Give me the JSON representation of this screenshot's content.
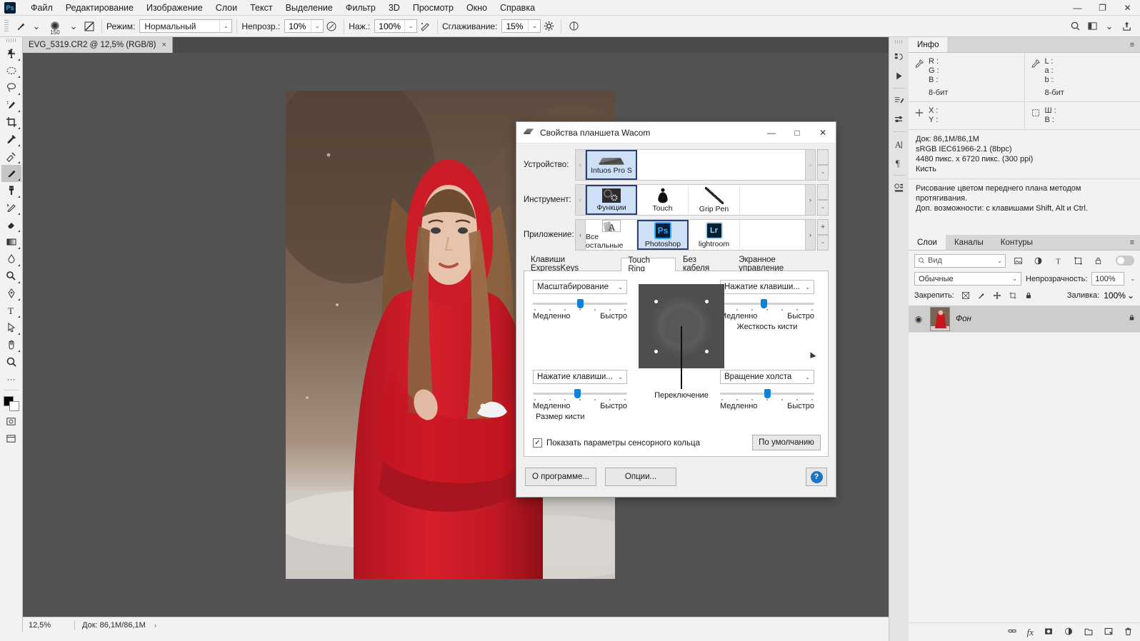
{
  "app": {
    "logo_text": "Ps",
    "menu": [
      "Файл",
      "Редактирование",
      "Изображение",
      "Слои",
      "Текст",
      "Выделение",
      "Фильтр",
      "3D",
      "Просмотр",
      "Окно",
      "Справка"
    ],
    "window_controls": {
      "minimize": "—",
      "maximize": "❐",
      "close": "✕"
    }
  },
  "options_bar": {
    "brush_size": "150",
    "mode_label": "Режим:",
    "mode_value": "Нормальный",
    "opacity_label": "Непрозр.:",
    "opacity_value": "10%",
    "pressure_label": "Наж.:",
    "pressure_value": "100%",
    "smoothing_label": "Сглаживание:",
    "smoothing_value": "15%",
    "icons": [
      "brush-tool-icon",
      "brush-preset-picker-icon",
      "brush-panel-icon",
      "airbrush-icon",
      "pressure-opacity-icon",
      "pressure-size-icon",
      "smoothing-options-gear-icon",
      "symmetry-icon"
    ],
    "right_icons": [
      "search-icon",
      "workspace-switcher-icon",
      "chevron-down-icon",
      "share-icon"
    ]
  },
  "document_tab": {
    "title": "EVG_5319.CR2 @ 12,5% (RGB/8)",
    "close": "×"
  },
  "toolbar": {
    "tools": [
      {
        "name": "move-tool",
        "glyph": "move"
      },
      {
        "name": "elliptical-marquee-tool",
        "glyph": "ellipse"
      },
      {
        "name": "lasso-tool",
        "glyph": "lasso"
      },
      {
        "name": "quick-selection-tool",
        "glyph": "quickselect"
      },
      {
        "name": "crop-tool",
        "glyph": "crop"
      },
      {
        "name": "eyedropper-tool",
        "glyph": "eyedropper"
      },
      {
        "name": "spot-healing-brush-tool",
        "glyph": "healing"
      },
      {
        "name": "brush-tool",
        "glyph": "brush",
        "active": true
      },
      {
        "name": "clone-stamp-tool",
        "glyph": "stamp"
      },
      {
        "name": "history-brush-tool",
        "glyph": "historybrush"
      },
      {
        "name": "eraser-tool",
        "glyph": "eraser"
      },
      {
        "name": "gradient-tool",
        "glyph": "gradient"
      },
      {
        "name": "blur-tool",
        "glyph": "blur"
      },
      {
        "name": "dodge-tool",
        "glyph": "dodge"
      },
      {
        "name": "pen-tool",
        "glyph": "pen"
      },
      {
        "name": "type-tool",
        "glyph": "type"
      },
      {
        "name": "path-selection-tool",
        "glyph": "pathselect"
      },
      {
        "name": "rectangle-tool",
        "glyph": "rect"
      },
      {
        "name": "hand-tool",
        "glyph": "hand"
      },
      {
        "name": "zoom-tool",
        "glyph": "zoom"
      }
    ],
    "more_tools": "···",
    "foreground_color": "#000000",
    "background_color": "#ffffff",
    "extra": [
      "quick-mask-icon",
      "screen-mode-icon"
    ]
  },
  "status_bar": {
    "zoom": "12,5%",
    "doc": "Док: 86,1M/86,1M",
    "arrow": "›"
  },
  "dock_rail": {
    "icons": [
      "history-icon",
      "play-icon",
      "actions-icon",
      "adjustments-icon",
      "character-icon",
      "paragraph-icon",
      "libraries-icon"
    ]
  },
  "info_panel": {
    "tab": "Инфо",
    "menu_icon": "panel-menu-icon",
    "left_readout": {
      "icon": "eyedropper-icon",
      "rows": [
        "R :",
        "G :",
        "B :"
      ],
      "bits": "8-бит"
    },
    "right_readout": {
      "icon": "eyedropper-icon",
      "rows": [
        "L :",
        "a :",
        "b :"
      ],
      "bits": "8-бит"
    },
    "coords": {
      "icon": "crosshair-icon",
      "rows": [
        "X :",
        "Y :"
      ]
    },
    "dimensions": {
      "icon": "selection-size-icon",
      "rows": [
        "Ш :",
        "В :"
      ]
    },
    "doc_lines": [
      "Док: 86,1M/86,1M",
      "sRGB IEC61966-2.1 (8bpc)",
      "4480 пикс. x 6720 пикс. (300 ppi)",
      "Кисть"
    ],
    "hint_lines": [
      "Рисование цветом переднего плана методом протягивания.",
      "Доп. возможности: с клавишами Shift, Alt и Ctrl."
    ]
  },
  "layers_panel": {
    "tabs": [
      "Слои",
      "Каналы",
      "Контуры"
    ],
    "active_tab": "Слои",
    "menu_icon": "panel-menu-icon",
    "filter_placeholder": "Вид",
    "filter_icons": [
      "filter-pixel-icon",
      "filter-adjustment-icon",
      "filter-type-icon",
      "filter-shape-icon",
      "filter-smart-icon"
    ],
    "blend_mode": "Обычные",
    "opacity_label": "Непрозрачность:",
    "opacity_value": "100%",
    "lock_label": "Закрепить:",
    "lock_icons": [
      "lock-transparent-icon",
      "lock-image-icon",
      "lock-position-icon",
      "lock-artboard-icon",
      "lock-all-icon"
    ],
    "fill_label": "Заливка:",
    "fill_value": "100%",
    "rows": [
      {
        "name": "Фон",
        "visible": true,
        "locked": true,
        "eye": "◉",
        "lock": "🔒"
      }
    ],
    "bottom_icons": [
      "link-layers-icon",
      "layer-style-fx-icon",
      "add-mask-icon",
      "adjustment-layer-icon",
      "new-group-icon",
      "new-layer-icon",
      "delete-layer-icon"
    ],
    "fx_label": "fx"
  },
  "wacom_dialog": {
    "title": "Свойства планшета Wacom",
    "title_icon": "tablet-icon",
    "window_controls": {
      "minimize": "—",
      "maximize": "□",
      "close": "✕"
    },
    "rows": [
      {
        "label": "Устройство:",
        "prev": "‹",
        "next": "›",
        "items": [
          {
            "label": "Intuos Pro S",
            "icon": "tablet-icon",
            "selected": true
          }
        ]
      },
      {
        "label": "Инструмент:",
        "prev": "‹",
        "next": "›",
        "items": [
          {
            "label": "Функции",
            "icon": "functions-icon",
            "selected": true
          },
          {
            "label": "Touch",
            "icon": "touch-icon",
            "selected": false
          },
          {
            "label": "Grip Pen",
            "icon": "pen-icon",
            "selected": false
          }
        ]
      },
      {
        "label": "Приложение:",
        "prev": "‹",
        "next": "›",
        "items": [
          {
            "label": "Все остальные",
            "icon": "all-other-apps-icon",
            "selected": false
          },
          {
            "label": "Photoshop",
            "icon": "photoshop-icon",
            "selected": true
          },
          {
            "label": "lightroom",
            "icon": "lightroom-icon",
            "selected": false
          }
        ],
        "add": "+",
        "remove": "-"
      }
    ],
    "tabs": [
      "Клавиши ExpressKeys",
      "Touch Ring",
      "Без кабеля",
      "Экранное управление"
    ],
    "active_tab": "Touch Ring",
    "controls": [
      {
        "name": "top-left",
        "function": "Масштабирование",
        "slow_label": "Медленно",
        "fast_label": "Быстро",
        "slider_percent": 47,
        "sub_label": ""
      },
      {
        "name": "top-right",
        "function": "Нажатие клавиши...",
        "slow_label": "Медленно",
        "fast_label": "Быстро",
        "slider_percent": 43,
        "sub_label": "Жесткость кисти"
      },
      {
        "name": "bottom-left",
        "function": "Нажатие клавиши...",
        "slow_label": "Медленно",
        "fast_label": "Быстро",
        "slider_percent": 44,
        "sub_label": "Размер кисти"
      },
      {
        "name": "bottom-right",
        "function": "Вращение холста",
        "slow_label": "Медленно",
        "fast_label": "Быстро",
        "slider_percent": 47,
        "sub_label": ""
      }
    ],
    "ring_preview": {
      "caption": "Переключение",
      "dots": 4
    },
    "show_ring_checkbox": {
      "label": "Показать параметры сенсорного кольца",
      "checked": true,
      "mark": "✓"
    },
    "default_button": "По умолчанию",
    "about_button": "О программе...",
    "options_button": "Опции...",
    "help_button": "?"
  }
}
